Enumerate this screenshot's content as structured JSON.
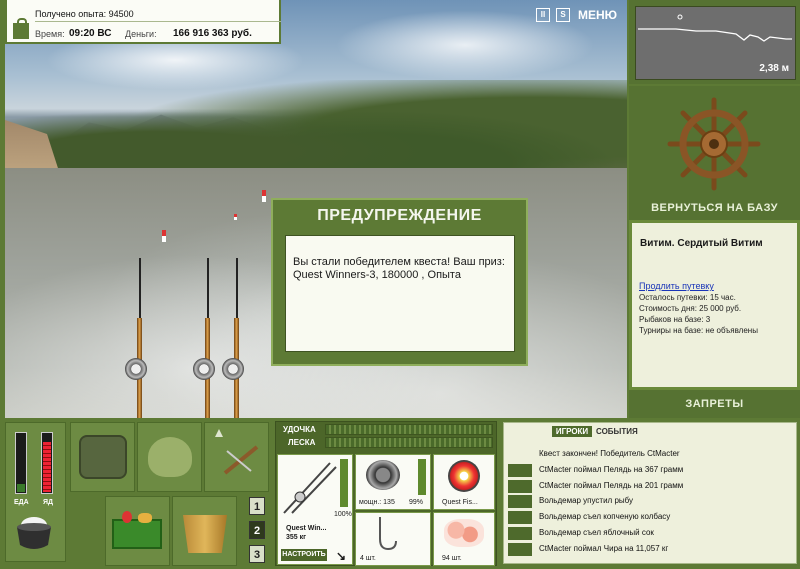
{
  "hud": {
    "experience": "Получено опыта: 94500",
    "time_label": "Время:",
    "time_value": "09:20 ВС",
    "money_label": "Деньги:",
    "money_value": "166 916 363 руб."
  },
  "scene_buttons": {
    "pause": "II",
    "sound": "S",
    "menu": "МЕНЮ"
  },
  "depth": {
    "value": "2,38 м"
  },
  "base": {
    "return_button": "ВЕРНУТЬСЯ НА БАЗУ"
  },
  "location": {
    "title": "Витим. Сердитый Витим",
    "extend_link": "Продлить путевку",
    "lines": [
      "Осталось путевки: 15 час.",
      "Стоимость дня: 25 000 руб.",
      "Рыбаков на базе: 3",
      "Турниры на базе: не объявлены"
    ]
  },
  "bans": {
    "label": "ЗАПРЕТЫ"
  },
  "modal": {
    "title": "ПРЕДУПРЕЖДЕНИЕ",
    "message": "Вы стали победителем квеста! Ваш приз: Quest Winners-3, 180000 , Опыта"
  },
  "status": {
    "food_label": "ЕДА",
    "alcohol_label": "ЯД"
  },
  "inventory_tabs": [
    "1",
    "2",
    "3"
  ],
  "tackle": {
    "rod_label": "УДОЧКА",
    "line_label": "ЛЕСКА",
    "rod_name": "Quest Win...",
    "rod_weight": "355 кг",
    "rod_condition": "100%",
    "reel_power": "мощн.: 135",
    "reel_condition": "99%",
    "line_name": "Quest Fis...",
    "hook_count": "4 шт.",
    "bait_count": "94 шт.",
    "setup_button": "НАСТРОИТЬ"
  },
  "events": {
    "tab_players": "ИГРОКИ",
    "tab_events": "СОБЫТИЯ",
    "items": [
      "Квест закончен! Победитель CtMacter",
      "CtMacter поймал Пелядь на 367 грамм",
      "CtMacter поймал Пелядь на 201 грамм",
      "Вольдемар упустил рыбу",
      "Вольдемар съел копченую колбасу",
      "Вольдемар съел яблочный сок",
      "CtMacter поймал Чира на 11,057 кг"
    ]
  }
}
